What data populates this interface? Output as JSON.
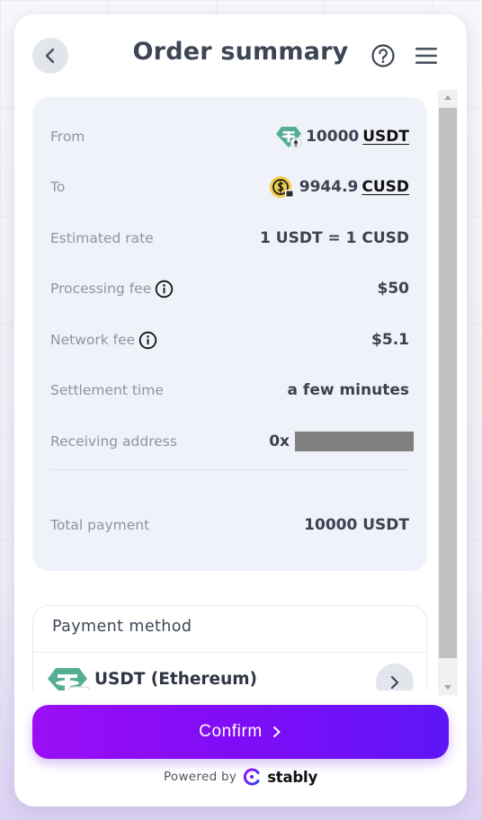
{
  "header": {
    "title": "Order summary"
  },
  "summary": {
    "from": {
      "label": "From",
      "amount": "10000",
      "currency": "USDT"
    },
    "to": {
      "label": "To",
      "amount": "9944.9",
      "currency": "CUSD"
    },
    "rate": {
      "label": "Estimated rate",
      "value": "1 USDT = 1 CUSD"
    },
    "processing_fee": {
      "label": "Processing fee",
      "value": "$50"
    },
    "network_fee": {
      "label": "Network fee",
      "value": "$5.1"
    },
    "settlement": {
      "label": "Settlement time",
      "value": "a few minutes"
    },
    "address": {
      "label": "Receiving address",
      "prefix": "0x"
    },
    "total": {
      "label": "Total payment",
      "value": "10000 USDT"
    }
  },
  "payment_method": {
    "title": "Payment method",
    "name": "USDT (Ethereum)"
  },
  "confirm": {
    "label": "Confirm"
  },
  "footer": {
    "powered_by": "Powered by",
    "brand": "stably"
  },
  "colors": {
    "accent_start": "#9a0ef5",
    "accent_end": "#5f15f8",
    "usdt_green": "#53ae94",
    "cusd_yellow": "#f2cc4b",
    "panel_bg": "#eff2f8"
  },
  "icons": {
    "back": "chevron-left-icon",
    "help": "question-circle-icon",
    "menu": "hamburger-menu-icon",
    "info": "info-circle-icon",
    "usdt": "tether-icon",
    "cusd": "celo-dollar-icon",
    "eth": "ethereum-icon",
    "confirm_arrow": "chevron-right-icon",
    "stably": "stably-logo-icon"
  }
}
